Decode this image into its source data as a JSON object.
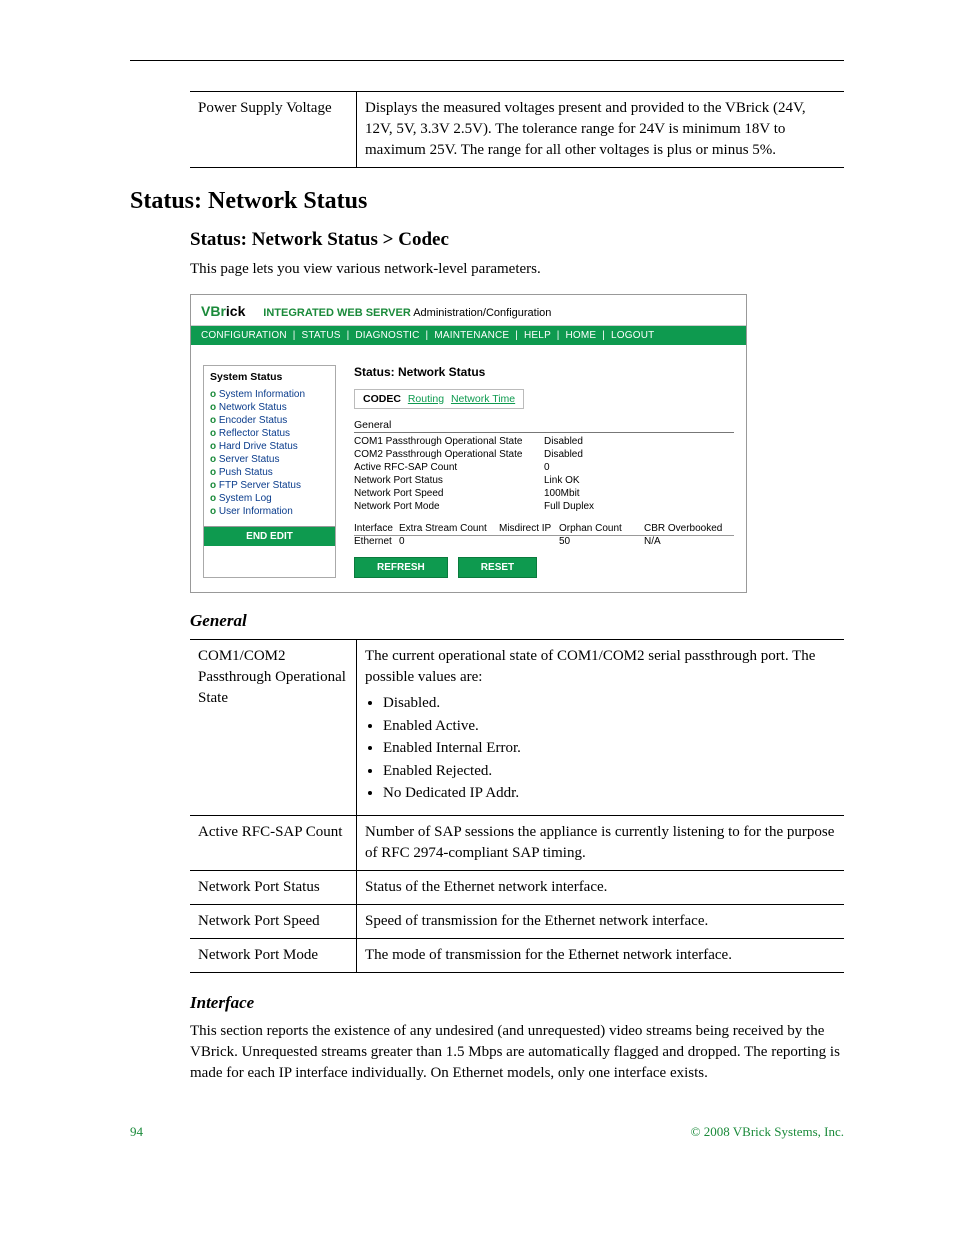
{
  "top_table": {
    "rows": [
      {
        "term": "Power Supply Voltage",
        "desc": "Displays the measured voltages present and provided to the VBrick (24V, 12V, 5V, 3.3V 2.5V). The tolerance range for 24V is minimum 18V to maximum 25V. The range for all other voltages is plus or minus 5%."
      }
    ]
  },
  "section_title": "Status: Network Status",
  "subsection_title": "Status: Network Status > Codec",
  "intro_para": "This page lets you view various network-level parameters.",
  "panel": {
    "brand_part1": "VBr",
    "brand_part2": "ick",
    "header_label_bold": "INTEGRATED WEB SERVER",
    "header_label_rest": "Administration/Configuration",
    "nav_items": [
      "CONFIGURATION",
      "STATUS",
      "DIAGNOSTIC",
      "MAINTENANCE",
      "HELP",
      "HOME",
      "LOGOUT"
    ],
    "sidebar_title": "System Status",
    "sidebar_items": [
      "System Information",
      "Network Status",
      "Encoder Status",
      "Reflector Status",
      "Hard Drive Status",
      "Server Status",
      "Push Status",
      "FTP Server Status",
      "System Log",
      "User Information"
    ],
    "end_edit_label": "END EDIT",
    "main_title": "Status: Network Status",
    "tabs": {
      "active": "CODEC",
      "links": [
        "Routing",
        "Network Time"
      ]
    },
    "general_label": "General",
    "general_rows": [
      {
        "k": "COM1 Passthrough Operational State",
        "v": "Disabled"
      },
      {
        "k": "COM2 Passthrough Operational State",
        "v": "Disabled"
      },
      {
        "k": "Active RFC-SAP Count",
        "v": "0"
      },
      {
        "k": "Network Port Status",
        "v": "Link OK"
      },
      {
        "k": "Network Port Speed",
        "v": "100Mbit"
      },
      {
        "k": "Network Port Mode",
        "v": "Full Duplex"
      }
    ],
    "iface_headers": [
      "Interface",
      "Extra Stream Count",
      "Misdirect IP",
      "Orphan Count",
      "CBR Overbooked"
    ],
    "iface_row": [
      "Ethernet",
      "0",
      "",
      "50",
      "N/A"
    ],
    "refresh_label": "REFRESH",
    "reset_label": "RESET"
  },
  "general_heading": "General",
  "general_table": {
    "rows": [
      {
        "term": "COM1/COM2 Passthrough Operational State",
        "desc_intro": "The current operational state of COM1/COM2 serial passthrough port. The possible values are:",
        "bullets": [
          "Disabled.",
          "Enabled Active.",
          "Enabled Internal Error.",
          "Enabled Rejected.",
          "No Dedicated IP Addr."
        ]
      },
      {
        "term": "Active RFC-SAP Count",
        "desc": "Number of SAP sessions the appliance is currently listening to for the purpose of RFC 2974-compliant SAP timing."
      },
      {
        "term": "Network Port Status",
        "desc": "Status of the Ethernet network interface."
      },
      {
        "term": "Network Port Speed",
        "desc": "Speed of transmission for the Ethernet network interface."
      },
      {
        "term": "Network Port Mode",
        "desc": "The mode of transmission for the Ethernet network interface."
      }
    ]
  },
  "interface_heading": "Interface",
  "interface_para": "This section reports the existence of any undesired (and unrequested) video streams being received by the VBrick. Unrequested streams greater than 1.5 Mbps are automatically flagged and dropped. The reporting is made for each IP interface individually. On Ethernet models, only one interface exists.",
  "footer": {
    "page_num": "94",
    "copyright": "© 2008 VBrick Systems, Inc."
  }
}
